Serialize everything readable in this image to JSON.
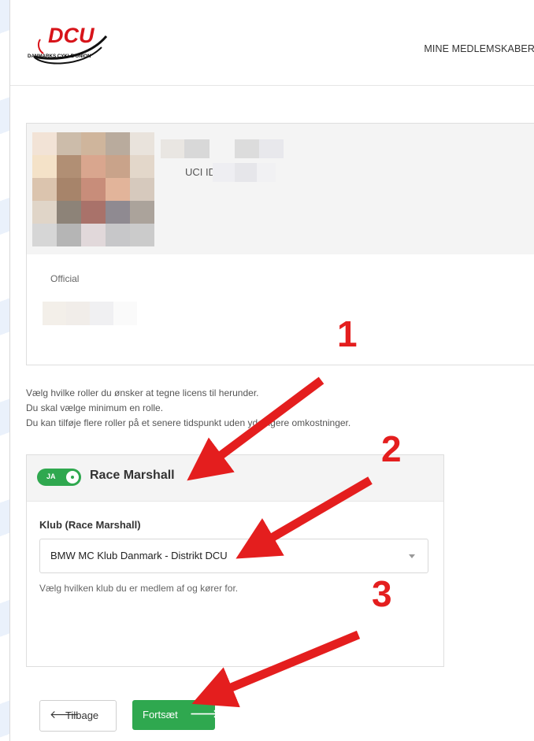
{
  "header": {
    "logo": {
      "mark": "DCU",
      "subtitle": "DANMARKS CYKLE UNION"
    },
    "nav_link": "MINE MEDLEMSKABER"
  },
  "profile": {
    "uci_label": "UCI ID",
    "role_label": "Official"
  },
  "intro": {
    "line1": "Vælg hvilke roller du ønsker at tegne licens til herunder.",
    "line2": "Du skal vælge minimum en rolle.",
    "line3": "Du kan tilføje flere roller på et senere tidspunkt uden yderligere omkostninger."
  },
  "role_card": {
    "toggle_label": "JA",
    "title": "Race Marshall",
    "club_label": "Klub (Race Marshall)",
    "club_value": "BMW MC Klub Danmark - Distrikt DCU",
    "help": "Vælg hvilken klub du er medlem af og kører for."
  },
  "buttons": {
    "back": "Tilbage",
    "next": "Fortsæt",
    "back_icon": "arrow-left-icon",
    "next_icon": "arrow-right-icon"
  },
  "annotations": {
    "steps": [
      "1",
      "2",
      "3"
    ],
    "color": "#e41e1e"
  },
  "colors": {
    "accent_green": "#2fa84f",
    "logo_red": "#d7141a"
  }
}
